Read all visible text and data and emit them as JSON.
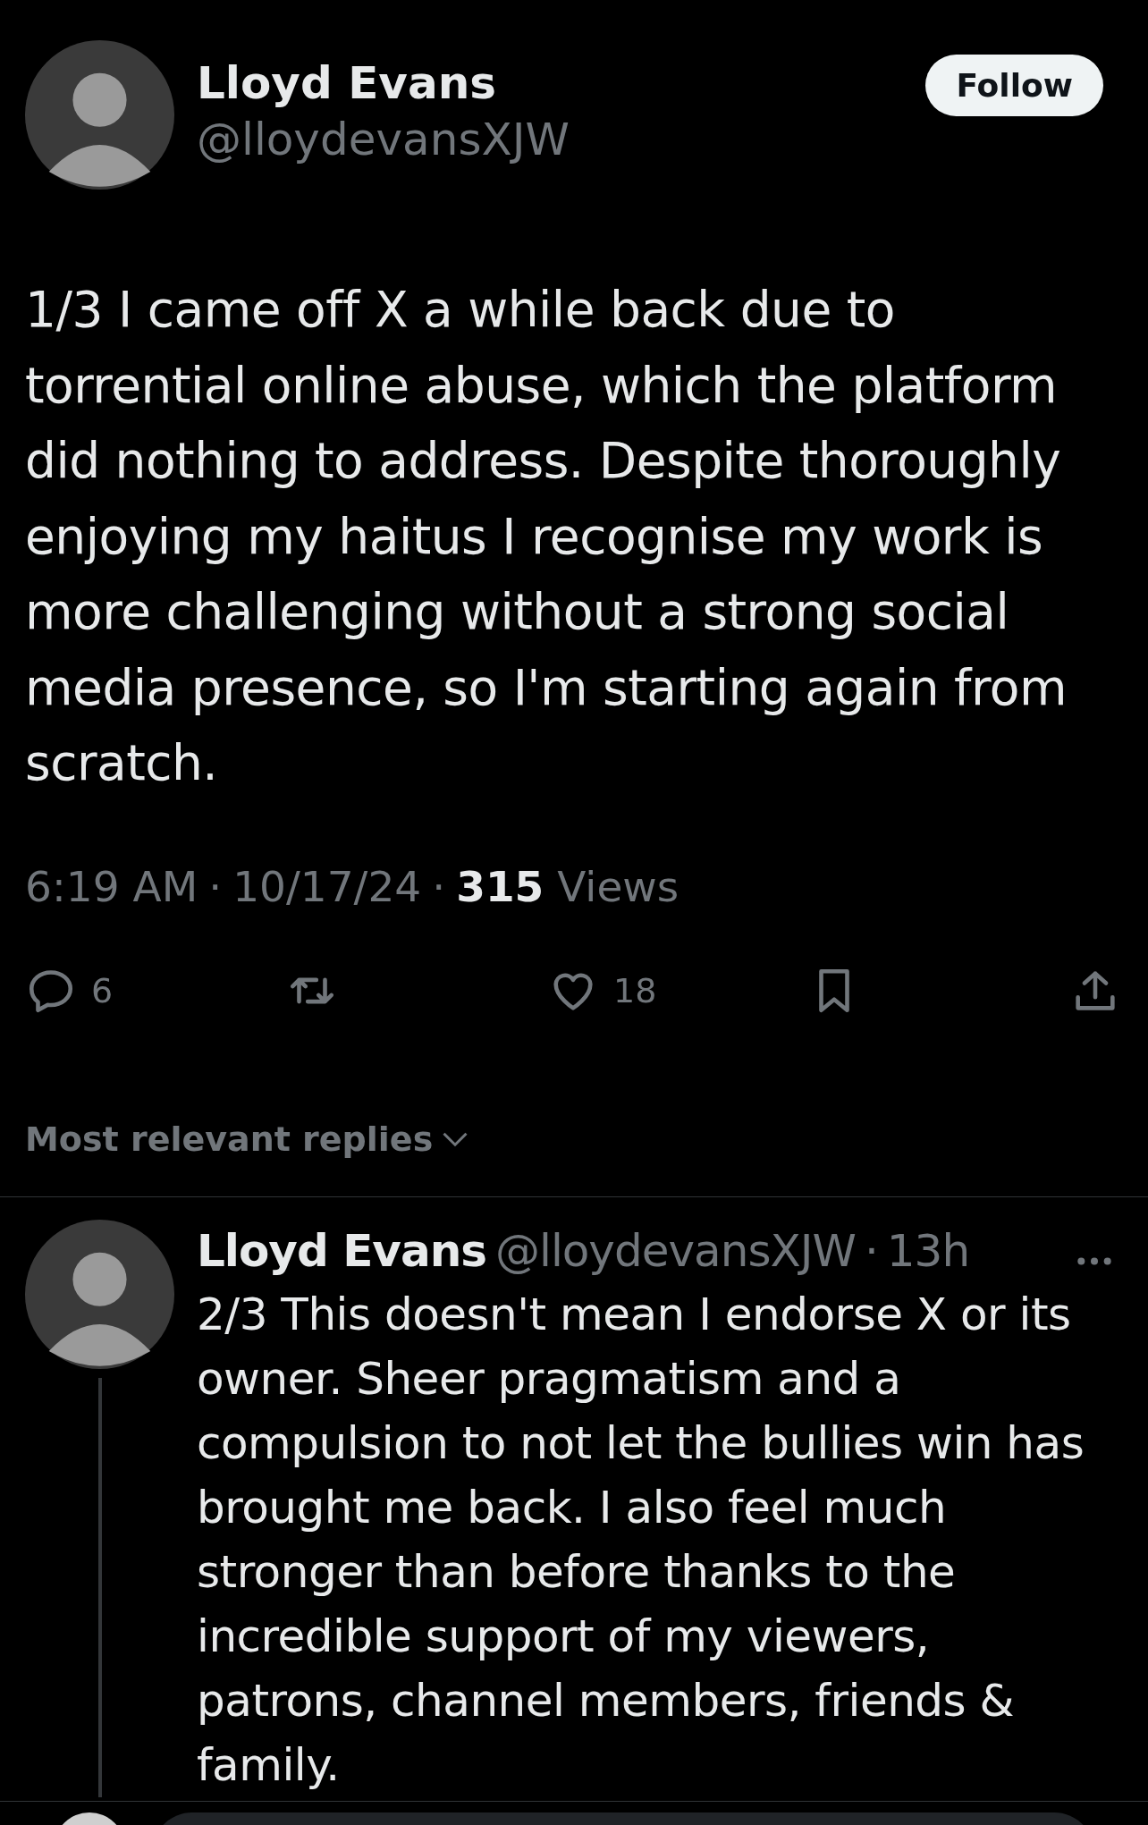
{
  "post": {
    "author": "Lloyd Evans",
    "handle": "@lloydevansXJW",
    "follow_button": "Follow",
    "text": "1/3 I came off X a while back due to torrential online abuse, which the platform did nothing to address. Despite thoroughly enjoying my haitus I recognise my work is more challenging without a strong social media presence, so I'm starting again from scratch.",
    "time": "6:19 AM",
    "separator": "·",
    "date": "10/17/24",
    "views_count": "315",
    "views_label": "Views",
    "actions": [
      {
        "kind": "reply",
        "count": "6"
      },
      {
        "kind": "repost"
      },
      {
        "kind": "like",
        "count": "18"
      },
      {
        "kind": "bookmark"
      },
      {
        "kind": "share"
      }
    ]
  },
  "replies_sort": "Most relevant replies",
  "replies": [
    {
      "author": "Lloyd Evans",
      "handle": "@lloydevansXJW",
      "separator": "·",
      "age": "13h",
      "text": "2/3 This doesn't mean I endorse X or its owner. Sheer pragmatism and a compulsion to not let the bullies win has brought me back. I also feel much stronger than before thanks to the incredible support of my viewers, patrons, channel members, friends & family."
    }
  ]
}
